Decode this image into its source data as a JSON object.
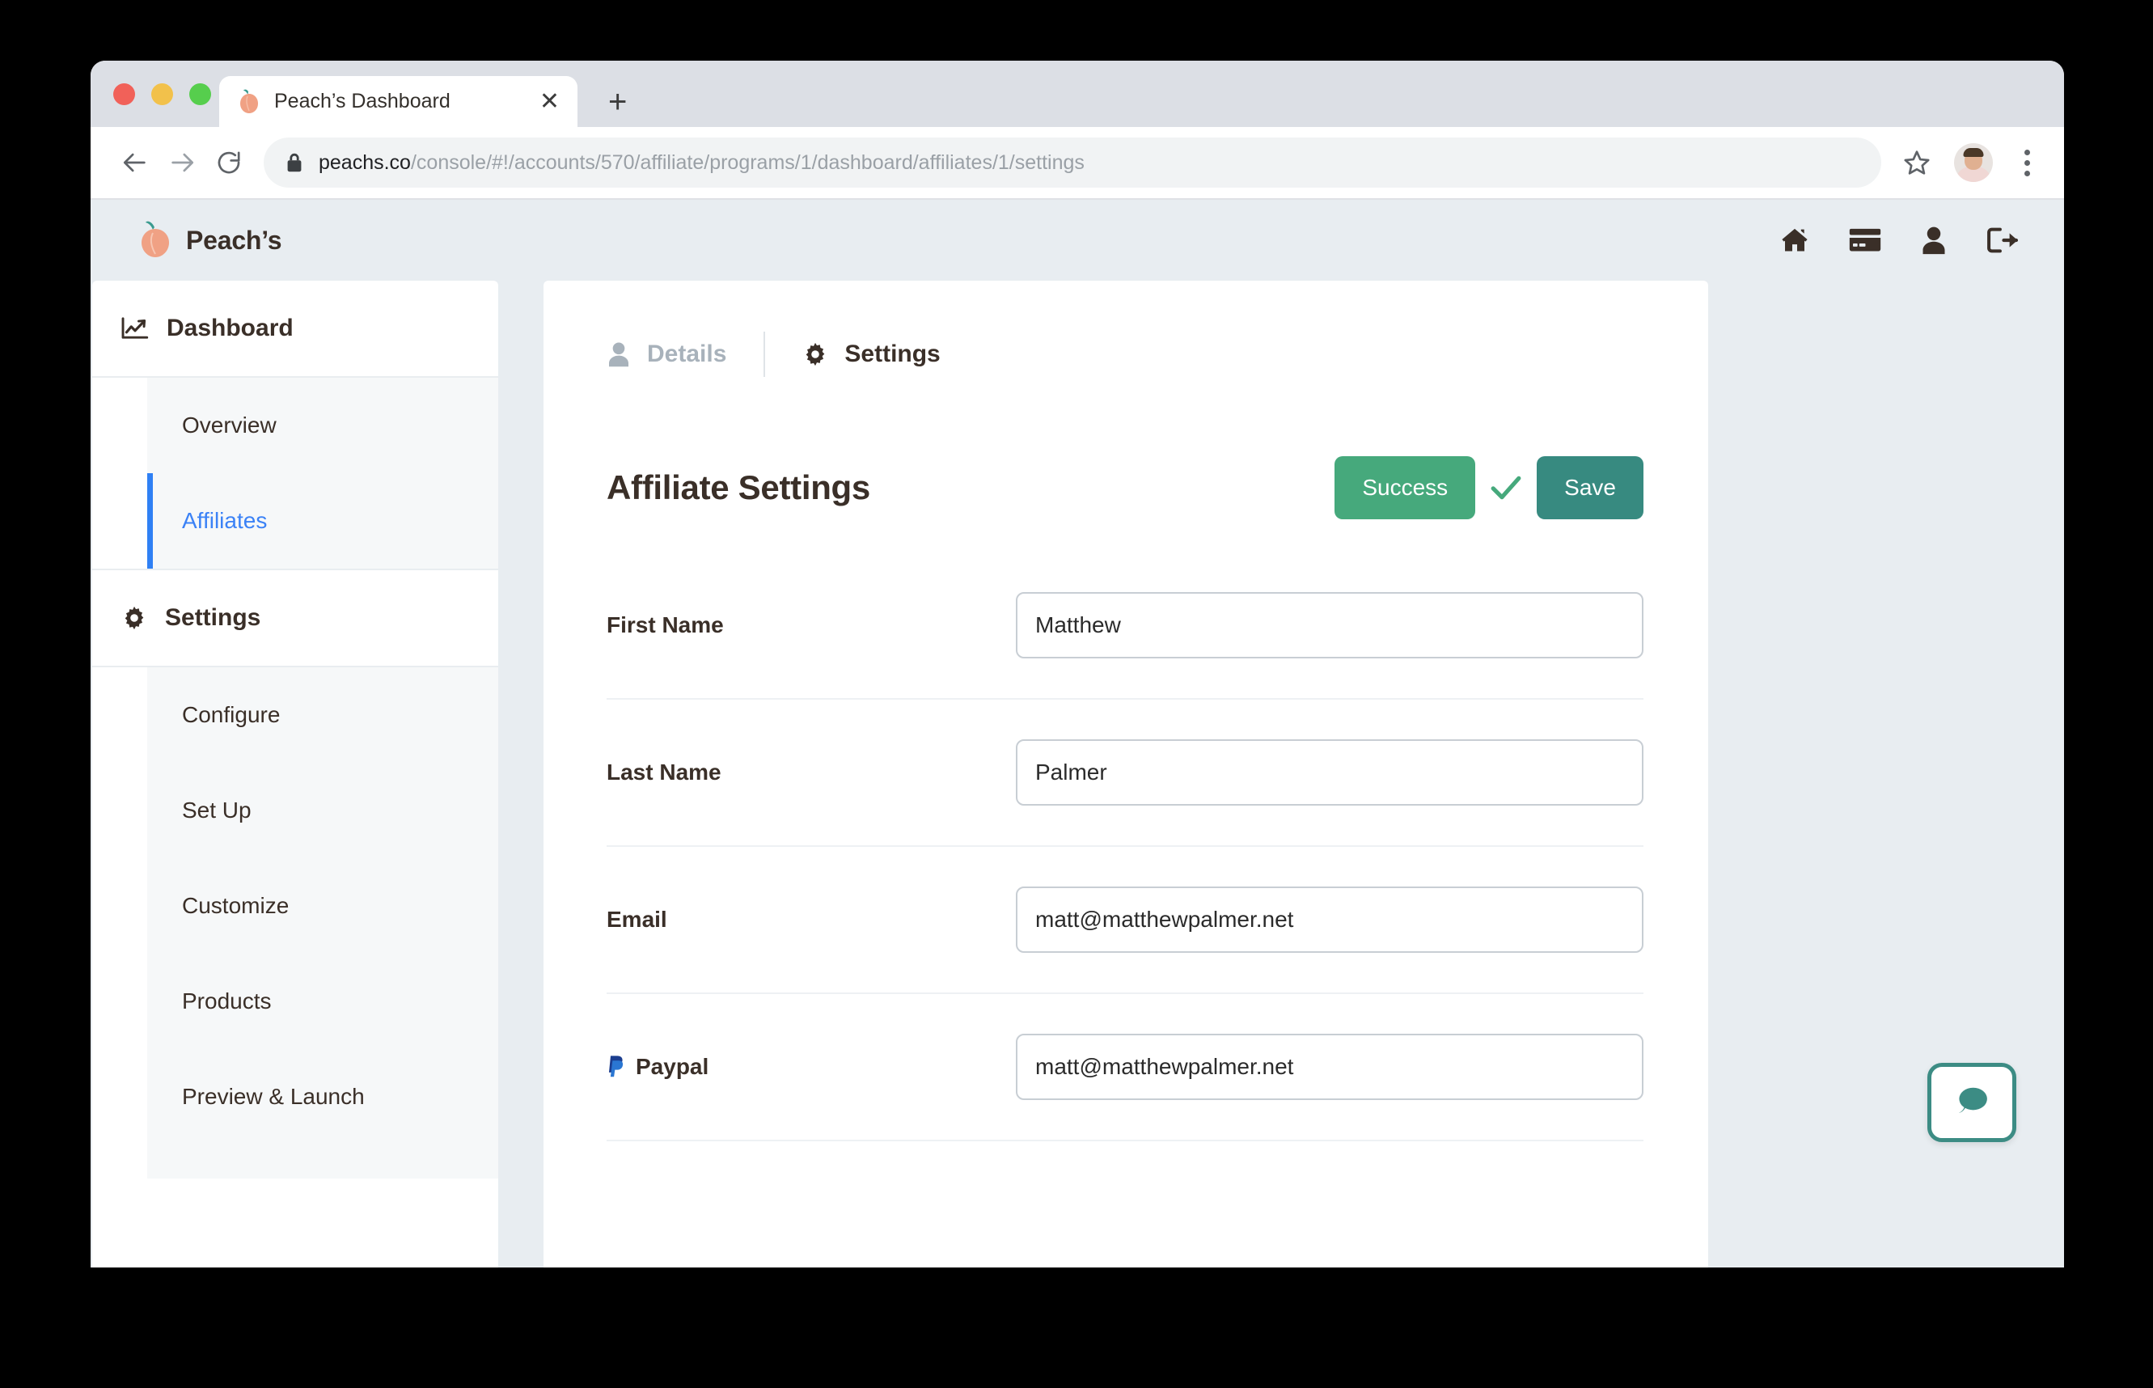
{
  "browser": {
    "tab": {
      "title": "Peach’s Dashboard",
      "favicon": "peach-icon",
      "close_label": "✕"
    },
    "new_tab_label": "+",
    "url": {
      "host": "peachs.co",
      "path": "/console/#!/accounts/570/affiliate/programs/1/dashboard/affiliates/1/settings"
    },
    "icons": {
      "back": "back-arrow-icon",
      "forward": "forward-arrow-icon",
      "reload": "reload-icon",
      "lock": "lock-icon",
      "bookmark": "star-icon",
      "profile": "avatar-icon",
      "menu": "kebab-menu-icon"
    }
  },
  "app_header": {
    "brand": "Peach’s",
    "icons": [
      {
        "name": "home-icon"
      },
      {
        "name": "credit-card-icon"
      },
      {
        "name": "user-icon"
      },
      {
        "name": "sign-out-icon"
      }
    ]
  },
  "sidebar": {
    "groups": [
      {
        "label": "Dashboard",
        "icon": "chart-line-icon",
        "items": [
          {
            "label": "Overview",
            "active": false
          },
          {
            "label": "Affiliates",
            "active": true
          }
        ]
      },
      {
        "label": "Settings",
        "icon": "gear-icon",
        "items": [
          {
            "label": "Configure",
            "active": false
          },
          {
            "label": "Set Up",
            "active": false
          },
          {
            "label": "Customize",
            "active": false
          },
          {
            "label": "Products",
            "active": false
          },
          {
            "label": "Preview & Launch",
            "active": false
          }
        ]
      }
    ]
  },
  "main": {
    "tabs": [
      {
        "label": "Details",
        "icon": "user-icon",
        "active": false
      },
      {
        "label": "Settings",
        "icon": "gear-icon",
        "active": true
      }
    ],
    "title": "Affiliate Settings",
    "buttons": {
      "success_label": "Success",
      "save_label": "Save",
      "success_color": "#46a97c",
      "save_color": "#378a80",
      "check_color": "#46a97c"
    },
    "fields": [
      {
        "label": "First Name",
        "value": "Matthew",
        "icon": null
      },
      {
        "label": "Last Name",
        "value": "Palmer",
        "icon": null
      },
      {
        "label": "Email",
        "value": "matt@matthewpalmer.net",
        "icon": null
      },
      {
        "label": "Paypal",
        "value": "matt@matthewpalmer.net",
        "icon": "paypal-icon"
      }
    ]
  },
  "chat_widget": {
    "icon": "chat-bubble-icon",
    "color": "#3c8c84"
  }
}
